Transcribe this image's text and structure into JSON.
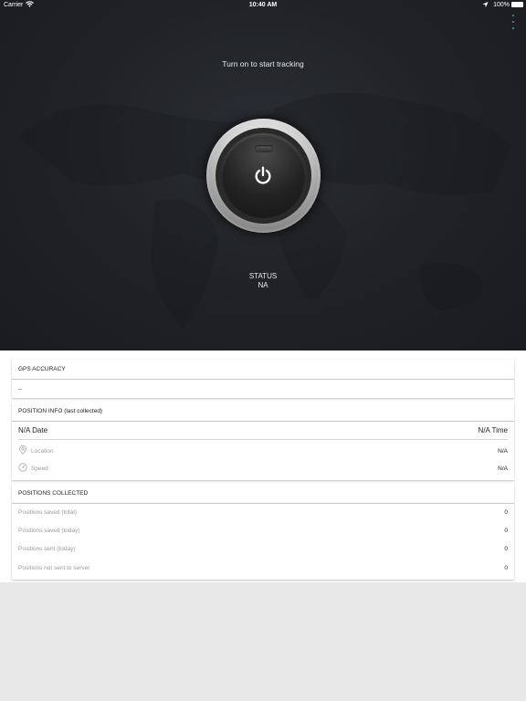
{
  "status_bar": {
    "carrier": "Carrier",
    "time": "10:40 AM",
    "battery": "100%"
  },
  "hero": {
    "prompt": "Turn on to start tracking",
    "status_label": "STATUS",
    "status_value": "NA",
    "accent_color": "#3fb26a"
  },
  "gps_accuracy": {
    "header": "GPS ACCURACY",
    "value": "--"
  },
  "position_info": {
    "header": "POSITION INFO (last collected)",
    "date": "N/A Date",
    "time": "N/A Time",
    "location_label": "Location",
    "location_value": "N/A",
    "speed_label": "Speed",
    "speed_value": "N/A"
  },
  "positions_collected": {
    "header": "POSITIONS COLLECTED",
    "rows": [
      {
        "label": "Positions saved (total)",
        "value": "0"
      },
      {
        "label": "Positions saved (today)",
        "value": "0"
      },
      {
        "label": "Positions sent (today)",
        "value": "0"
      },
      {
        "label": "Positions not sent to server",
        "value": "0"
      }
    ]
  }
}
